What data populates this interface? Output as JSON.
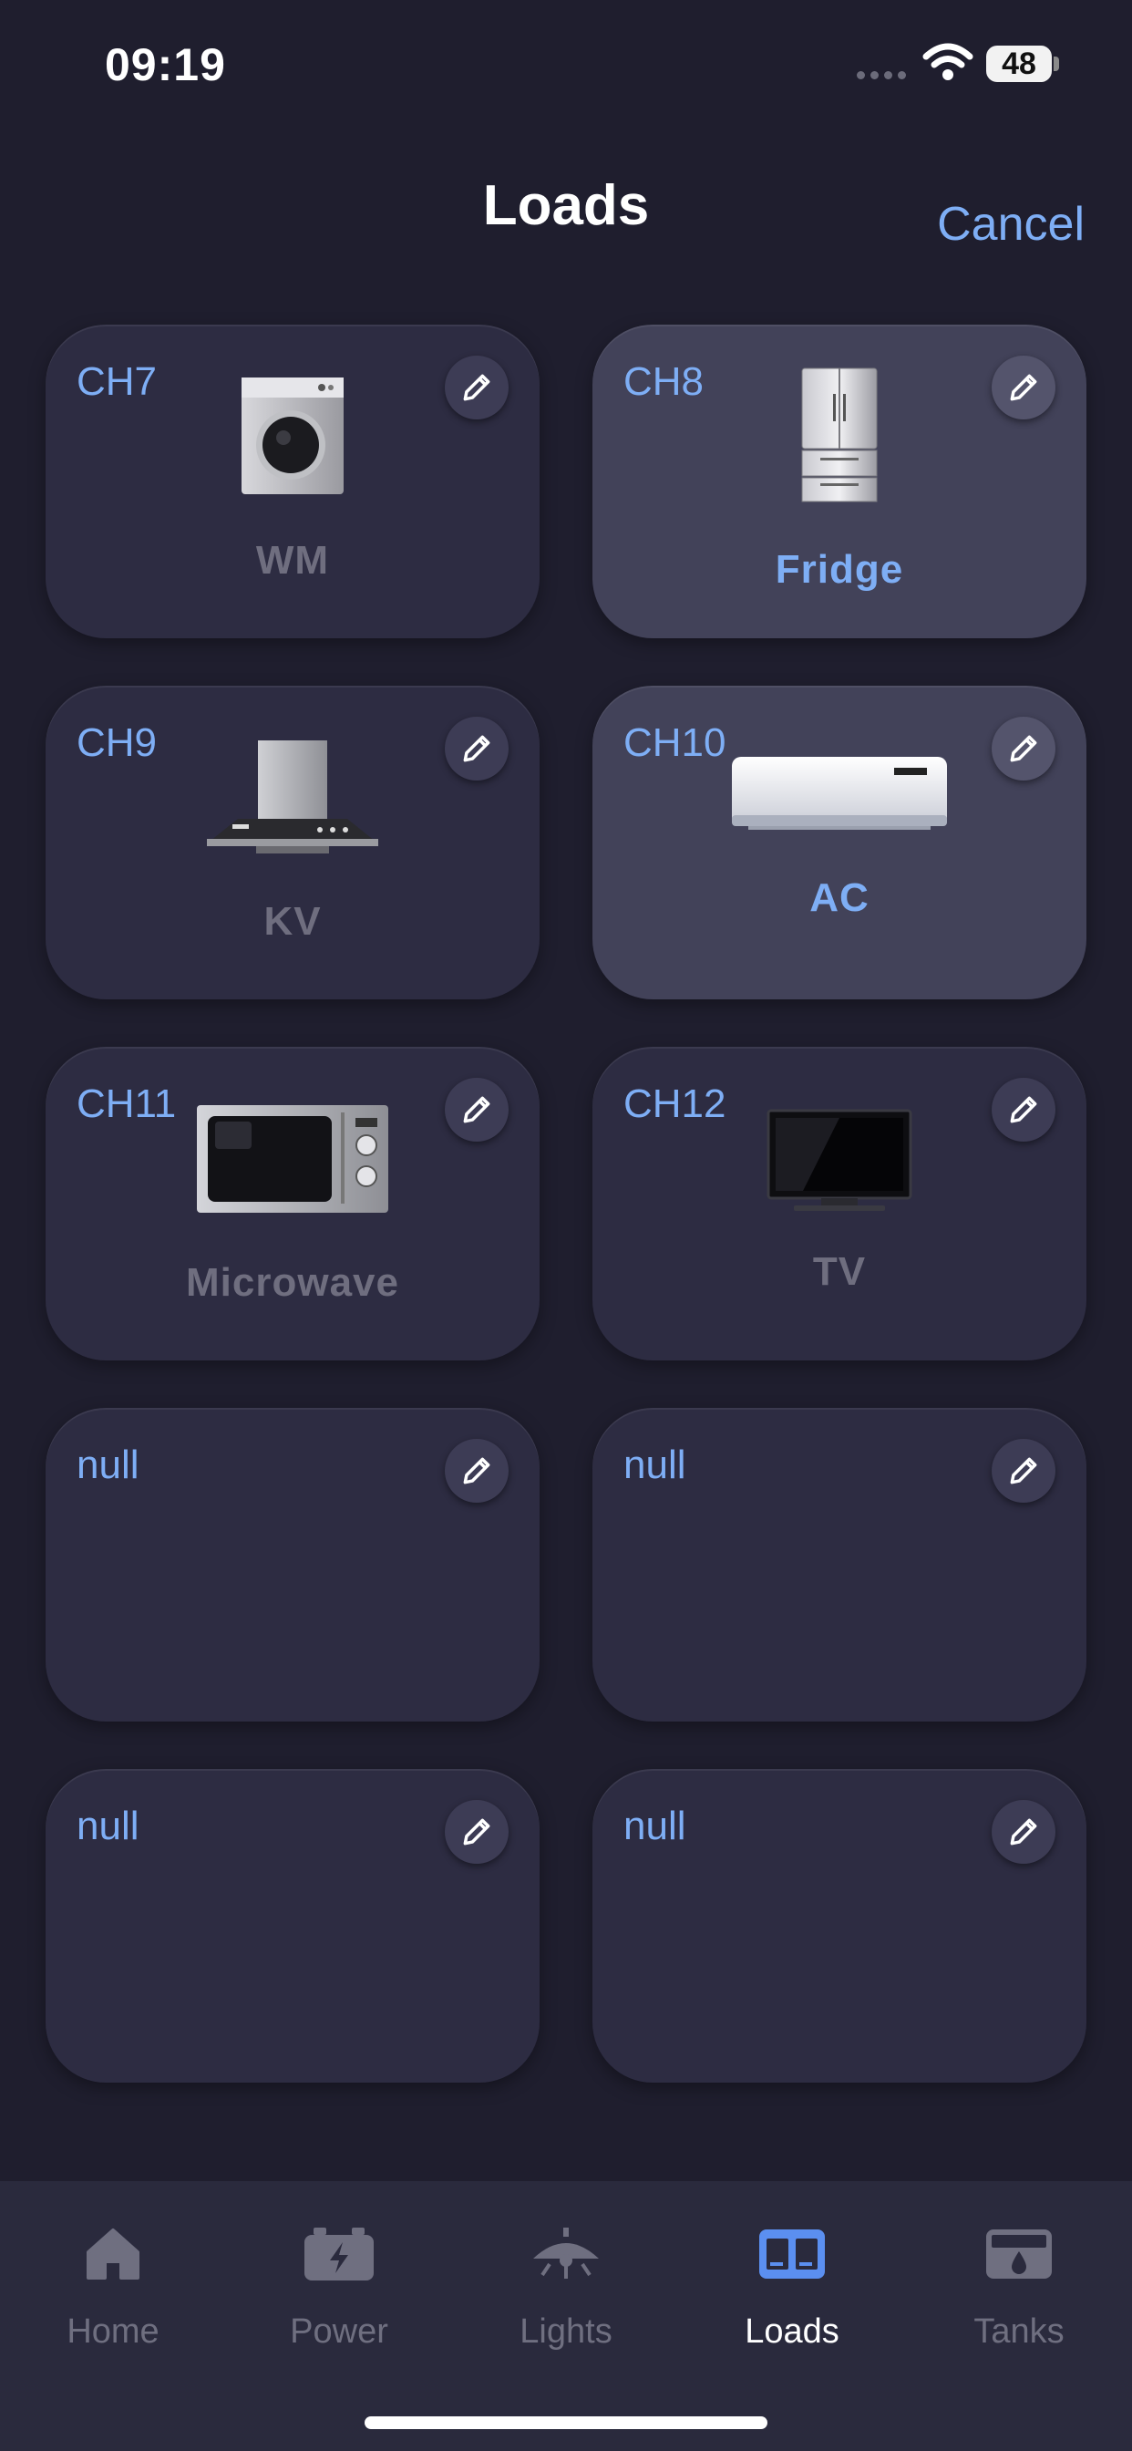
{
  "status_bar": {
    "time": "09:19",
    "battery": "48"
  },
  "header": {
    "title": "Loads",
    "cancel_label": "Cancel"
  },
  "cards": [
    {
      "channel": "CH7",
      "name": "WM",
      "icon": "washing-machine-icon",
      "active": false
    },
    {
      "channel": "CH8",
      "name": "Fridge",
      "icon": "fridge-icon",
      "active": true
    },
    {
      "channel": "CH9",
      "name": "KV",
      "icon": "kitchen-hood-icon",
      "active": false
    },
    {
      "channel": "CH10",
      "name": "AC",
      "icon": "air-conditioner-icon",
      "active": true
    },
    {
      "channel": "CH11",
      "name": "Microwave",
      "icon": "microwave-icon",
      "active": false
    },
    {
      "channel": "CH12",
      "name": "TV",
      "icon": "tv-icon",
      "active": false
    },
    {
      "channel": "null",
      "name": "",
      "icon": "",
      "active": false
    },
    {
      "channel": "null",
      "name": "",
      "icon": "",
      "active": false
    },
    {
      "channel": "null",
      "name": "",
      "icon": "",
      "active": false
    },
    {
      "channel": "null",
      "name": "",
      "icon": "",
      "active": false
    }
  ],
  "tabs": [
    {
      "label": "Home",
      "icon": "home-icon",
      "selected": false
    },
    {
      "label": "Power",
      "icon": "battery-icon",
      "selected": false
    },
    {
      "label": "Lights",
      "icon": "lamp-icon",
      "selected": false
    },
    {
      "label": "Loads",
      "icon": "loads-icon",
      "selected": true
    },
    {
      "label": "Tanks",
      "icon": "tank-icon",
      "selected": false
    }
  ],
  "colors": {
    "accent": "#7eaef5",
    "background": "#1f1e2e",
    "card": "#2d2c42",
    "card_active": "#424259",
    "inactive_text": "#6f6e7f"
  }
}
